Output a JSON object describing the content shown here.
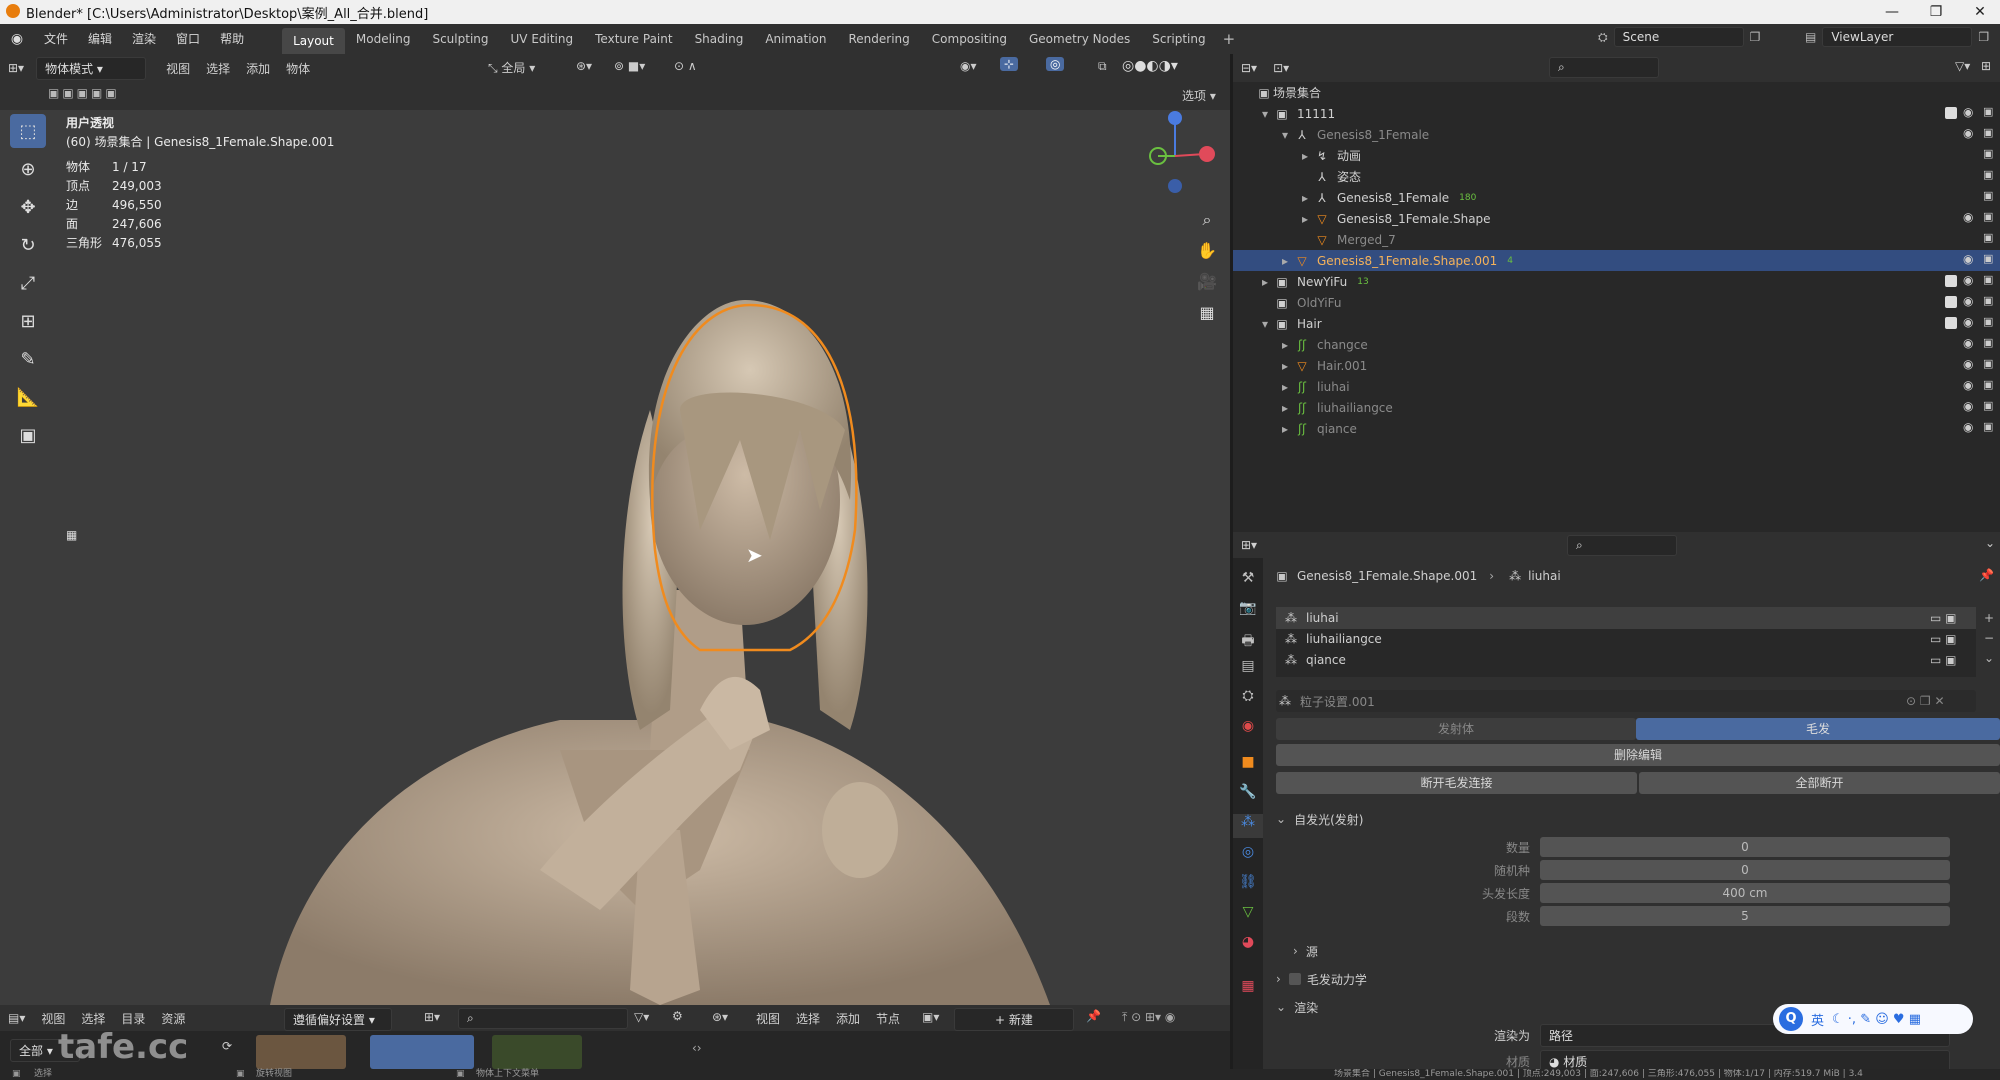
{
  "window": {
    "title": "Blender* [C:\\Users\\Administrator\\Desktop\\案例_All_合并.blend]"
  },
  "menu": [
    "文件",
    "编辑",
    "渲染",
    "窗口",
    "帮助"
  ],
  "workspaces": [
    "Layout",
    "Modeling",
    "Sculpting",
    "UV Editing",
    "Texture Paint",
    "Shading",
    "Animation",
    "Rendering",
    "Compositing",
    "Geometry Nodes",
    "Scripting"
  ],
  "scene": {
    "name": "Scene",
    "view_layer": "ViewLayer"
  },
  "viewport_header": {
    "mode": "物体模式",
    "menus": [
      "视图",
      "选择",
      "添加",
      "物体"
    ],
    "transform": "全局",
    "options": "选项"
  },
  "viewport": {
    "view_name": "用户透视",
    "collection_info": "(60) 场景集合 | Genesis8_1Female.Shape.001",
    "stats": [
      {
        "label": "物体",
        "value": "1 / 17"
      },
      {
        "label": "顶点",
        "value": "249,003"
      },
      {
        "label": "边",
        "value": "496,550"
      },
      {
        "label": "面",
        "value": "247,606"
      },
      {
        "label": "三角形",
        "value": "476,055"
      }
    ]
  },
  "outliner": {
    "root": "场景集合",
    "rows": [
      {
        "label": "11111",
        "indent": 0,
        "exp": "▾",
        "icon": "▣",
        "dim": false,
        "sel": false,
        "checkbox": true,
        "eye": true
      },
      {
        "label": "Genesis8_1Female",
        "indent": 1,
        "exp": "▾",
        "icon": "⅄",
        "dim": true,
        "sel": false,
        "checkbox": false,
        "eye": true
      },
      {
        "label": "动画",
        "indent": 2,
        "exp": "▸",
        "icon": "↯",
        "dim": false,
        "sel": false,
        "checkbox": false,
        "eye": false
      },
      {
        "label": "姿态",
        "indent": 2,
        "exp": "",
        "icon": "⅄",
        "dim": false,
        "sel": false,
        "checkbox": false,
        "eye": false
      },
      {
        "label": "Genesis8_1Female",
        "indent": 2,
        "exp": "▸",
        "icon": "⅄",
        "dim": false,
        "sel": false,
        "checkbox": false,
        "eye": false,
        "badge": "180"
      },
      {
        "label": "Genesis8_1Female.Shape",
        "indent": 2,
        "exp": "▸",
        "icon": "▽",
        "dim": false,
        "sel": false,
        "checkbox": false,
        "eye": true
      },
      {
        "label": "Merged_7",
        "indent": 2,
        "exp": "",
        "icon": "▽",
        "dim": true,
        "sel": false,
        "checkbox": false,
        "eye": false
      },
      {
        "label": "Genesis8_1Female.Shape.001",
        "indent": 1,
        "exp": "▸",
        "icon": "▽",
        "dim": false,
        "sel": true,
        "checkbox": false,
        "eye": true,
        "badge": "4"
      },
      {
        "label": "NewYiFu",
        "indent": 0,
        "exp": "▸",
        "icon": "▣",
        "dim": false,
        "sel": false,
        "checkbox": true,
        "eye": true,
        "badge": "13"
      },
      {
        "label": "OldYiFu",
        "indent": 0,
        "exp": "",
        "icon": "▣",
        "dim": true,
        "sel": false,
        "checkbox": true,
        "eye": true
      },
      {
        "label": "Hair",
        "indent": 0,
        "exp": "▾",
        "icon": "▣",
        "dim": false,
        "sel": false,
        "checkbox": true,
        "eye": true
      },
      {
        "label": "changce",
        "indent": 1,
        "exp": "▸",
        "icon": "ʃʃ",
        "dim": true,
        "sel": false,
        "checkbox": false,
        "eye": true
      },
      {
        "label": "Hair.001",
        "indent": 1,
        "exp": "▸",
        "icon": "▽",
        "dim": true,
        "sel": false,
        "checkbox": false,
        "eye": true
      },
      {
        "label": "liuhai",
        "indent": 1,
        "exp": "▸",
        "icon": "ʃʃ",
        "dim": true,
        "sel": false,
        "checkbox": false,
        "eye": true
      },
      {
        "label": "liuhailiangce",
        "indent": 1,
        "exp": "▸",
        "icon": "ʃʃ",
        "dim": true,
        "sel": false,
        "checkbox": false,
        "eye": true
      },
      {
        "label": "qiance",
        "indent": 1,
        "exp": "▸",
        "icon": "ʃʃ",
        "dim": true,
        "sel": false,
        "checkbox": false,
        "eye": true
      }
    ]
  },
  "properties": {
    "breadcrumb_obj": "Genesis8_1Female.Shape.001",
    "breadcrumb_psys": "liuhai",
    "psys_list": [
      "liuhai",
      "liuhailiangce",
      "qiance"
    ],
    "settings_name": "粒子设置.001",
    "tabs": [
      "发射体",
      "毛发"
    ],
    "delete_edit": "删除编辑",
    "disconnect": "断开毛发连接",
    "disconnect_all": "全部断开",
    "emission": {
      "title": "自发光(发射)",
      "fields": [
        {
          "label": "数量",
          "value": "0"
        },
        {
          "label": "随机种",
          "value": "0"
        },
        {
          "label": "头发长度",
          "value": "400 cm"
        },
        {
          "label": "段数",
          "value": "5"
        }
      ]
    },
    "source": "源",
    "hair_dynamics": "毛发动力学",
    "render": "渲染",
    "render_as_label": "渲染为",
    "render_as_value": "路径",
    "material_label": "材质",
    "material_value": "材质"
  },
  "asset_browser": {
    "menus": [
      "视图",
      "选择",
      "目录",
      "资源"
    ],
    "library": "遵循偏好设置",
    "library_all": "全部"
  },
  "node_editor": {
    "menus": [
      "视图",
      "选择",
      "添加",
      "节点"
    ],
    "new_btn": "新建"
  },
  "statusbar": {
    "left": "选择",
    "mid": "旋转视图",
    "ctx": "物体上下文菜单",
    "right": "场景集合 | Genesis8_1Female.Shape.001 | 顶点:249,003 | 面:247,606 | 三角形:476,055 | 物体:1/17 | 内存:519.7 MiB | 3.4"
  },
  "watermark": "tafe.cc",
  "ime": {
    "lang": "英"
  }
}
